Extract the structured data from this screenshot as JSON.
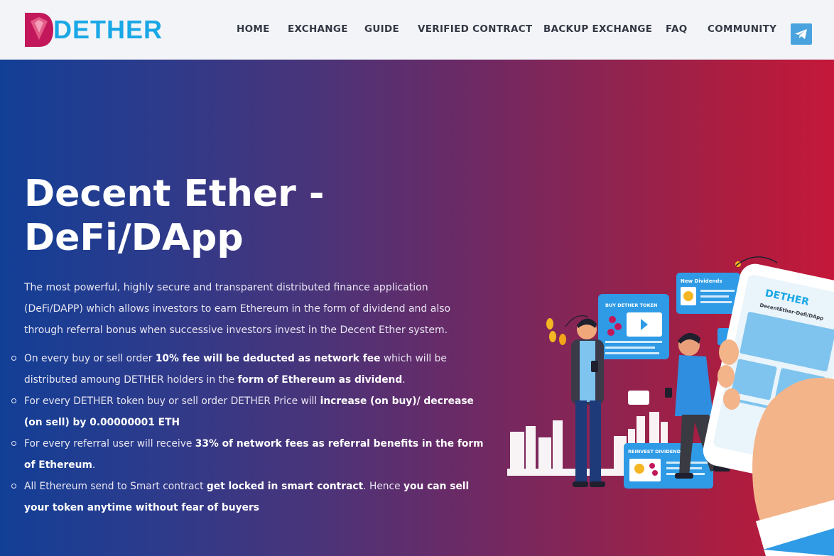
{
  "brand": {
    "name": "DETHER",
    "accent": "#1aa7e6",
    "mark_color": "#c2185b"
  },
  "nav": {
    "items": [
      {
        "label": "HOME"
      },
      {
        "label": "EXCHANGE"
      },
      {
        "label": "GUIDE"
      },
      {
        "label": "VERIFIED CONTRACT"
      },
      {
        "label": "BACKUP EXCHANGE"
      },
      {
        "label": "FAQ"
      },
      {
        "label": "COMMUNITY"
      }
    ],
    "telegram_icon": "telegram-icon"
  },
  "hero": {
    "title": "Decent Ether -\nDeFi/DApp",
    "intro": "The most powerful, highly secure and transparent distributed finance application (DeFi/DAPP) which allows investors to earn Ethereum in the form of dividend and also through referral bonus when successive investors invest in the Decent Ether system.",
    "bullets": [
      [
        {
          "t": "On every buy or sell order ",
          "b": false
        },
        {
          "t": "10% fee will be deducted as network fee",
          "b": true
        },
        {
          "t": " which will be distributed amoung DETHER holders in the ",
          "b": false
        },
        {
          "t": "form of Ethereum as dividend",
          "b": true
        },
        {
          "t": ".",
          "b": false
        }
      ],
      [
        {
          "t": "For every DETHER token buy or sell order DETHER Price will ",
          "b": false
        },
        {
          "t": "increase (on buy)/ decrease (on sell) by 0.00000001 ETH",
          "b": true
        }
      ],
      [
        {
          "t": "For every referral user will receive ",
          "b": false
        },
        {
          "t": "33% of network fees as referral benefits in the form of Ethereum",
          "b": true
        },
        {
          "t": ".",
          "b": false
        }
      ],
      [
        {
          "t": "All Ethereum send to Smart contract ",
          "b": false
        },
        {
          "t": "get locked in smart contract",
          "b": true
        },
        {
          "t": ". Hence ",
          "b": false
        },
        {
          "t": "you can sell your token anytime without fear of buyers",
          "b": true
        }
      ]
    ],
    "gradient": [
      "#123f96",
      "#c4183a"
    ]
  },
  "illustration": {
    "card_buy_title": "BUY DETHER TOKEN",
    "card_dividends_title": "New Dividends",
    "card_reinvest_title": "REINVEST DIVIDENDS",
    "phone_brand": "DETHER",
    "phone_subtitle": "DecentEther-Defi/DApp",
    "card_color": "#2f9be6"
  }
}
